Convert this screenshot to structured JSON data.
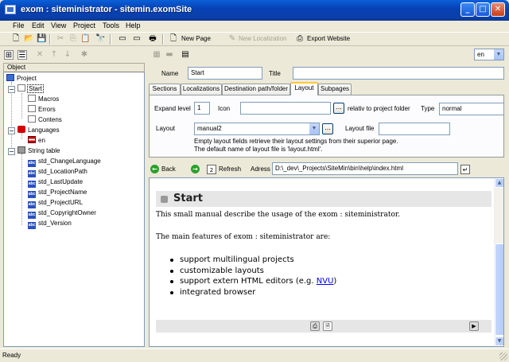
{
  "window": {
    "title": "exom : siteministrator - sitemin.exomSite",
    "minimize": "_",
    "maximize": "□",
    "close": "✕"
  },
  "menu": [
    "File",
    "Edit",
    "View",
    "Project",
    "Tools",
    "Help"
  ],
  "toolbar": {
    "new_page": "New Page",
    "new_localization": "New Localization",
    "export_website": "Export Website"
  },
  "tree": {
    "header": "Object",
    "root": "Project",
    "start": "Start",
    "start_children": [
      "Macros",
      "Errors",
      "Contens"
    ],
    "languages": "Languages",
    "language_items": [
      "en"
    ],
    "string_table": "String table",
    "strings": [
      "std_ChangeLanguage",
      "std_LocationPath",
      "std_LastUpdate",
      "std_ProjectName",
      "std_ProjectURL",
      "std_CopyrightOwner",
      "std_Version"
    ]
  },
  "language_select": "en",
  "props": {
    "name_label": "Name",
    "name_value": "Start",
    "title_label": "Title",
    "title_value": ""
  },
  "tabs": [
    "Sections",
    "Localizations",
    "Destination path/folder",
    "Layout",
    "Subpages"
  ],
  "layout_tab": {
    "expand_label": "Expand level",
    "expand_value": "1",
    "icon_label": "Icon",
    "icon_value": "",
    "browse": "...",
    "relativ": "relativ to project folder",
    "type_label": "Type",
    "type_value": "normal",
    "layout_label": "Layout",
    "layout_value": "manual2",
    "layout_file_label": "Layout file",
    "layout_file_value": "",
    "hint1": "Empty layout fields retrieve their layout settings from their superior page.",
    "hint2": "The default name of layout file is 'layout.html'."
  },
  "browser": {
    "back": "Back",
    "refresh": "Refresh",
    "address_label": "Adress",
    "address": "D:\\_dev\\_Projects\\SiteMin\\bin\\help\\index.html"
  },
  "page": {
    "heading": "Start",
    "intro": "This small manual describe the usage of the exom : siteministrator.",
    "features_intro": "The main features of exom : siteministrator are:",
    "features": [
      "support multilingual projects",
      "customizable layouts",
      "support extern HTML editors (e.g. ",
      "integrated browser"
    ],
    "nvu_link": "NVU",
    "nvu_suffix": ")"
  },
  "status": "Ready"
}
